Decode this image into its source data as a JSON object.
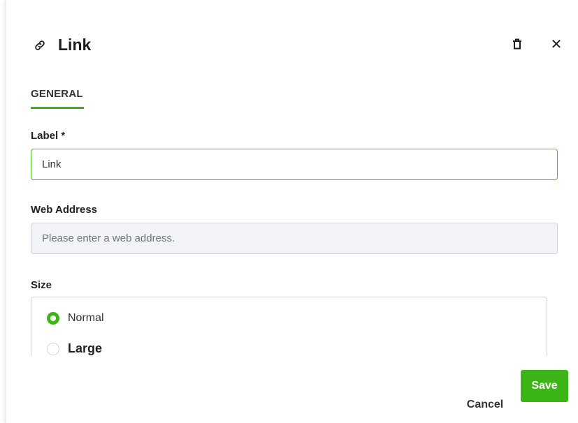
{
  "dialog": {
    "title": "Link",
    "title_icon": "link-icon",
    "delete_icon": "trash-icon",
    "close_icon": "close-icon",
    "close_glyph": "✕"
  },
  "tabs": [
    {
      "label": "GENERAL",
      "active": true
    }
  ],
  "fields": {
    "label": {
      "label": "Label *",
      "value": "Link"
    },
    "web_address": {
      "label": "Web Address",
      "value": "",
      "placeholder": "Please enter a web address."
    },
    "size": {
      "label": "Size",
      "options": [
        {
          "label": "Normal",
          "selected": true
        },
        {
          "label": "Large",
          "selected": false
        }
      ]
    }
  },
  "footer": {
    "cancel_label": "Cancel",
    "save_label": "Save"
  },
  "colors": {
    "accent": "#3cb517",
    "input_disabled_bg": "#f1f3f6",
    "border": "#cfd5db"
  }
}
